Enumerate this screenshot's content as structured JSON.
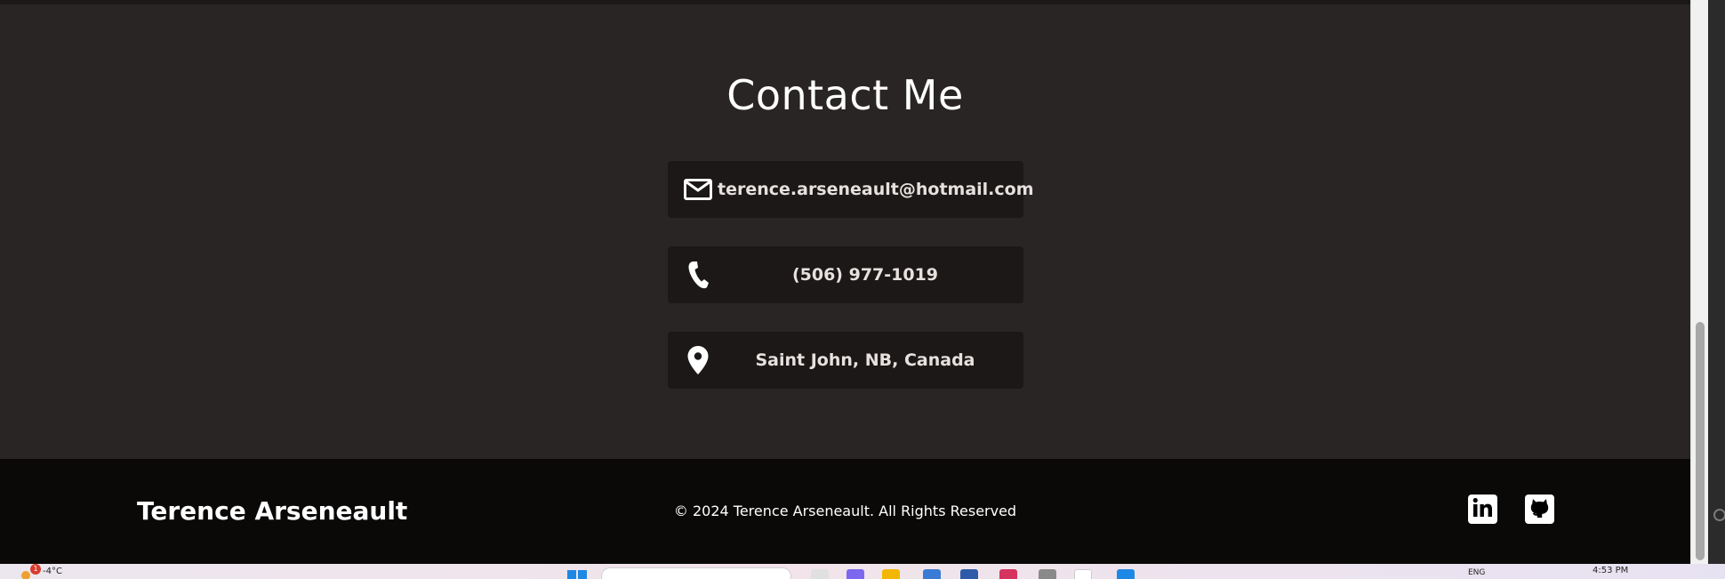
{
  "contact": {
    "title": "Contact Me",
    "email": "terence.arseneault@hotmail.com",
    "phone": "(506) 977-1019",
    "location": "Saint John, NB, Canada",
    "email_icon": "mail-icon",
    "phone_icon": "phone-icon",
    "location_icon": "map-pin-icon"
  },
  "footer": {
    "name": "Terence Arseneault",
    "copyright": "© 2024 Terence Arseneault. All Rights Reserved",
    "social": [
      {
        "icon": "linkedin-icon"
      },
      {
        "icon": "github-icon"
      }
    ]
  },
  "taskbar": {
    "notification_count": "1",
    "temperature": "-4°C",
    "language": "ENG",
    "time": "4:53 PM"
  },
  "colors": {
    "section_bg": "#2a2525",
    "card_bg": "#1b1817",
    "footer_bg": "#0a0908",
    "text": "#ffffff"
  }
}
